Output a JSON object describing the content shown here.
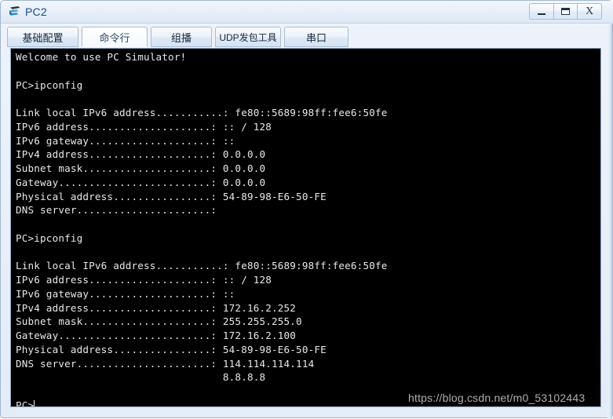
{
  "window": {
    "title": "PC2",
    "icon": "pc-device-icon",
    "controls": [
      {
        "name": "minimize-button",
        "icon": "minimize-icon",
        "label": "–"
      },
      {
        "name": "maximize-button",
        "icon": "maximize-icon",
        "label": "□"
      },
      {
        "name": "close-button",
        "icon": "close-icon",
        "label": "X"
      }
    ]
  },
  "tabs": [
    {
      "label": "基础配置",
      "selected": false
    },
    {
      "label": "命令行",
      "selected": true
    },
    {
      "label": "组播",
      "selected": false
    },
    {
      "label": "UDP发包工具",
      "selected": false
    },
    {
      "label": "串口",
      "selected": false
    }
  ],
  "terminal": {
    "prompt": "PC>",
    "text": "Welcome to use PC Simulator!\n\nPC>ipconfig\n\nLink local IPv6 address...........: fe80::5689:98ff:fee6:50fe\nIPv6 address....................: :: / 128\nIPv6 gateway....................: ::\nIPv4 address....................: 0.0.0.0\nSubnet mask.....................: 0.0.0.0\nGateway.........................: 0.0.0.0\nPhysical address................: 54-89-98-E6-50-FE\nDNS server......................:\n\nPC>ipconfig\n\nLink local IPv6 address...........: fe80::5689:98ff:fee6:50fe\nIPv6 address....................: :: / 128\nIPv6 gateway....................: ::\nIPv4 address....................: 172.16.2.252\nSubnet mask.....................: 255.255.255.0\nGateway.........................: 172.16.2.100\nPhysical address................: 54-89-98-E6-50-FE\nDNS server......................: 114.114.114.114\n                                  8.8.8.8\n\nPC>",
    "lines": [
      "Welcome to use PC Simulator!",
      "",
      "PC>ipconfig",
      "",
      "Link local IPv6 address...........: fe80::5689:98ff:fee6:50fe",
      "IPv6 address....................: :: / 128",
      "IPv6 gateway....................: ::",
      "IPv4 address....................: 0.0.0.0",
      "Subnet mask.....................: 0.0.0.0",
      "Gateway.........................: 0.0.0.0",
      "Physical address................: 54-89-98-E6-50-FE",
      "DNS server......................:",
      "",
      "PC>ipconfig",
      "",
      "Link local IPv6 address...........: fe80::5689:98ff:fee6:50fe",
      "IPv6 address....................: :: / 128",
      "IPv6 gateway....................: ::",
      "IPv4 address....................: 172.16.2.252",
      "Subnet mask.....................: 255.255.255.0",
      "Gateway.........................: 172.16.2.100",
      "Physical address................: 54-89-98-E6-50-FE",
      "DNS server......................: 114.114.114.114",
      "                                  8.8.8.8",
      "",
      "PC>"
    ],
    "background_color": "#000000",
    "text_color": "#e8e8e8"
  },
  "watermark": {
    "text": "https://blog.csdn.net/m0_53102443"
  }
}
